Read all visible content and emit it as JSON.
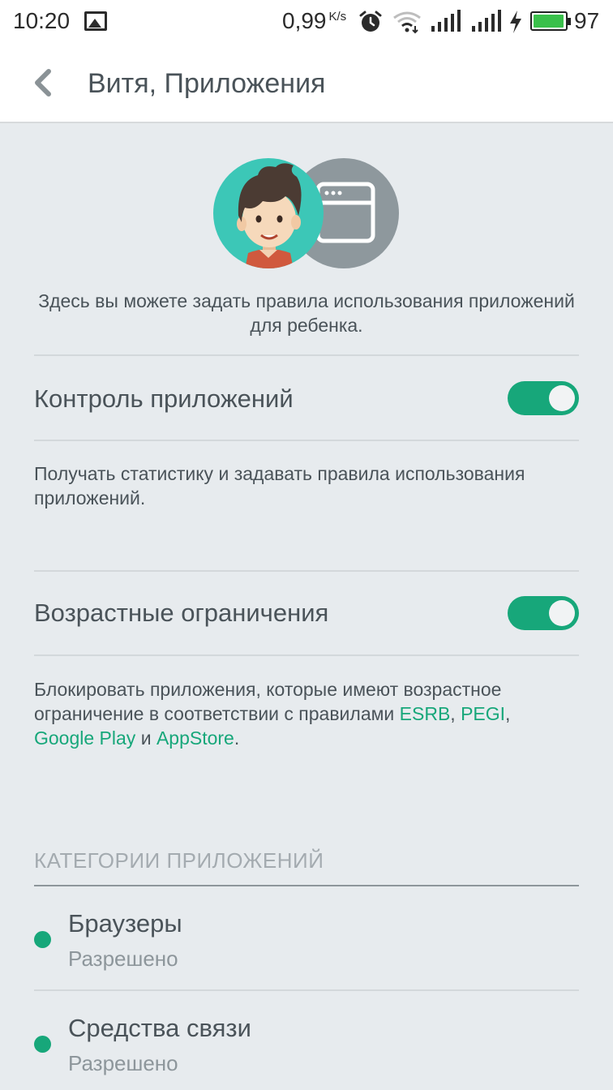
{
  "status_bar": {
    "time": "10:20",
    "speed": "0,99",
    "speed_unit": "K/s",
    "battery": "97",
    "icons": [
      "image-icon",
      "alarm-icon",
      "wifi-icon",
      "signal-icon",
      "signal-icon",
      "charging-icon",
      "battery-icon"
    ]
  },
  "header": {
    "title": "Витя, Приложения",
    "back_icon": "chevron-left-icon"
  },
  "intro": "Здесь вы можете задать правила использования приложений для ребенка.",
  "settings": [
    {
      "label": "Контроль приложений",
      "enabled": true,
      "description": "Получать статистику и задавать правила использования приложений."
    },
    {
      "label": "Возрастные ограничения",
      "enabled": true,
      "description_parts": {
        "text1": "Блокировать приложения, которые имеют возрастное ограничение в соответствии с правилами ",
        "link1": "ESRB",
        "sep1": ", ",
        "link2": "PEGI",
        "sep2": ",",
        "link3": "Google Play",
        "sep3": " и ",
        "link4": "AppStore",
        "end": "."
      }
    }
  ],
  "categories": {
    "header": "КАТЕГОРИИ ПРИЛОЖЕНИЙ",
    "items": [
      {
        "name": "Браузеры",
        "status": "Разрешено"
      },
      {
        "name": "Средства связи",
        "status": "Разрешено"
      }
    ]
  },
  "colors": {
    "accent": "#17a77a",
    "background": "#e7ebee",
    "text": "#4a5359",
    "muted": "#a4abb0",
    "avatar_bg": "#3cc7b7",
    "app_icon_bg": "#8e989d"
  }
}
